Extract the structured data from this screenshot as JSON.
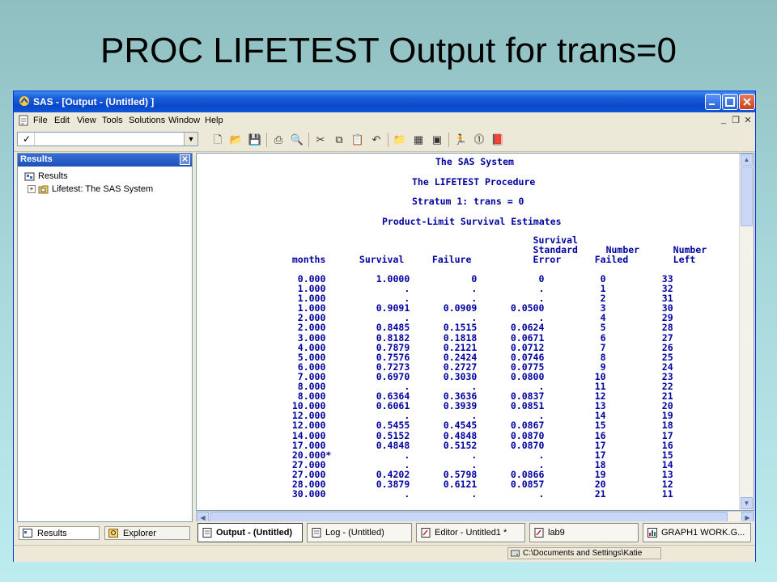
{
  "slide": {
    "title": "PROC LIFETEST Output for trans=0"
  },
  "window": {
    "title": "SAS - [Output - (Untitled) ]",
    "menu": [
      "File",
      "Edit",
      "View",
      "Tools",
      "Solutions",
      "Window",
      "Help"
    ]
  },
  "toolbar": {
    "command_value": ""
  },
  "results": {
    "header": "Results",
    "tree": [
      {
        "label": "Results",
        "icon": "results-folder-icon"
      },
      {
        "label": "Lifetest:  The SAS System",
        "icon": "folder-icon"
      }
    ],
    "tabs": [
      "Results",
      "Explorer"
    ]
  },
  "output": {
    "heading_lines": [
      "The SAS System",
      "The LIFETEST Procedure",
      "Stratum 1: trans = 0",
      "Product-Limit Survival Estimates"
    ],
    "column_header_lines": [
      "                                             Survival",
      "                                             Standard     Number      Number",
      "  months      Survival     Failure           Error      Failed        Left"
    ],
    "columns": [
      "months",
      "Survival",
      "Failure",
      "Survival Standard Error",
      "Number Failed",
      "Number Left"
    ],
    "rows": [
      [
        "0.000",
        "1.0000",
        "0",
        "0",
        "0",
        "33"
      ],
      [
        "1.000",
        ".",
        ".",
        ".",
        "1",
        "32"
      ],
      [
        "1.000",
        ".",
        ".",
        ".",
        "2",
        "31"
      ],
      [
        "1.000",
        "0.9091",
        "0.0909",
        "0.0500",
        "3",
        "30"
      ],
      [
        "2.000",
        ".",
        ".",
        ".",
        "4",
        "29"
      ],
      [
        "2.000",
        "0.8485",
        "0.1515",
        "0.0624",
        "5",
        "28"
      ],
      [
        "3.000",
        "0.8182",
        "0.1818",
        "0.0671",
        "6",
        "27"
      ],
      [
        "4.000",
        "0.7879",
        "0.2121",
        "0.0712",
        "7",
        "26"
      ],
      [
        "5.000",
        "0.7576",
        "0.2424",
        "0.0746",
        "8",
        "25"
      ],
      [
        "6.000",
        "0.7273",
        "0.2727",
        "0.0775",
        "9",
        "24"
      ],
      [
        "7.000",
        "0.6970",
        "0.3030",
        "0.0800",
        "10",
        "23"
      ],
      [
        "8.000",
        ".",
        ".",
        ".",
        "11",
        "22"
      ],
      [
        "8.000",
        "0.6364",
        "0.3636",
        "0.0837",
        "12",
        "21"
      ],
      [
        "10.000",
        "0.6061",
        "0.3939",
        "0.0851",
        "13",
        "20"
      ],
      [
        "12.000",
        ".",
        ".",
        ".",
        "14",
        "19"
      ],
      [
        "12.000",
        "0.5455",
        "0.4545",
        "0.0867",
        "15",
        "18"
      ],
      [
        "14.000",
        "0.5152",
        "0.4848",
        "0.0870",
        "16",
        "17"
      ],
      [
        "17.000",
        "0.4848",
        "0.5152",
        "0.0870",
        "17",
        "16"
      ],
      [
        "20.000*",
        ".",
        ".",
        ".",
        "17",
        "15"
      ],
      [
        "27.000",
        ".",
        ".",
        ".",
        "18",
        "14"
      ],
      [
        "27.000",
        "0.4202",
        "0.5798",
        "0.0866",
        "19",
        "13"
      ],
      [
        "28.000",
        "0.3879",
        "0.6121",
        "0.0857",
        "20",
        "12"
      ],
      [
        "30.000",
        ".",
        ".",
        ".",
        "21",
        "11"
      ]
    ]
  },
  "taskbar": [
    {
      "label": "Output - (Untitled)",
      "active": true
    },
    {
      "label": "Log - (Untitled)",
      "active": false
    },
    {
      "label": "Editor - Untitled1 *",
      "active": false
    },
    {
      "label": "lab9",
      "active": false
    },
    {
      "label": "GRAPH1  WORK.G...",
      "active": false
    }
  ],
  "status": {
    "path": "C:\\Documents and Settings\\Katie"
  },
  "colors": {
    "output_text": "#0000a0",
    "titlebar": "#0a47c9",
    "slide_bg": "#a6d7da"
  }
}
